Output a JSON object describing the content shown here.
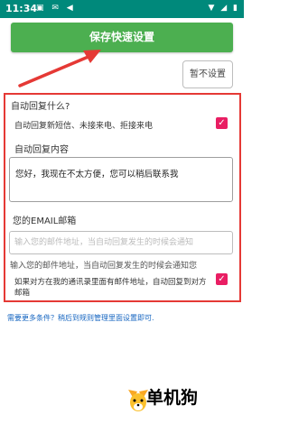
{
  "status_bar": {
    "time": "11:34",
    "left_icons": "▣ ✉ ◀",
    "right_icons": "▼ ◢ ▮"
  },
  "toolbar": {
    "save_label": "保存快速设置",
    "cancel_label": "暂不设置"
  },
  "auto_reply": {
    "section_title": "自动回复什么?",
    "option_label": "自动回复新短信、未接来电、拒接来电",
    "option_checked": true,
    "content_title": "自动回复内容",
    "content_value": "您好，我现在不太方便，您可以稍后联系我"
  },
  "email": {
    "section_title": "您的EMAIL邮箱",
    "placeholder": "输入您的邮件地址，当自动回复发生的时候会通知",
    "hint": "输入您的邮件地址，当自动回复发生的时候会通知您",
    "contacts_option": "如果对方在我的通讯录里面有邮件地址，自动回复到对方邮箱",
    "contacts_checked": true
  },
  "footer": {
    "more_link": "需要更多条件？稍后到规则管理里面设置即可."
  },
  "watermark": {
    "text": "单机狗"
  },
  "colors": {
    "status_bar": "#00897b",
    "save_button": "#4caf50",
    "checkbox": "#e91e63",
    "highlight_border": "#e53935",
    "link": "#1565c0"
  }
}
